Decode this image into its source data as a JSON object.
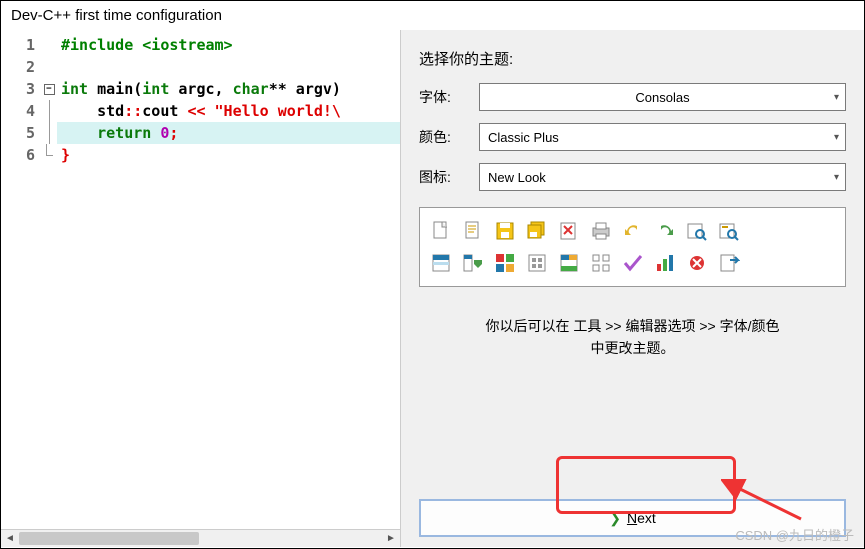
{
  "window": {
    "title": "Dev-C++ first time configuration"
  },
  "code": {
    "lines": [
      {
        "n": 1,
        "type": "pp",
        "text": "#include <iostream>"
      },
      {
        "n": 2,
        "type": "blank",
        "text": ""
      },
      {
        "n": 3,
        "type": "sig",
        "kw1": "int",
        "name": " main(",
        "kw2": "int",
        "mid": " argc, ",
        "kw3": "char",
        "rest": "** argv)"
      },
      {
        "n": 4,
        "type": "stmt",
        "pre": "    std",
        "op": "::",
        "mid": "cout ",
        "op2": "<<",
        "post": " ",
        "str": "\"Hello world!\\"
      },
      {
        "n": 5,
        "type": "ret",
        "pre": "    ",
        "kw": "return",
        "sp": " ",
        "num": "0",
        "semi": ";"
      },
      {
        "n": 6,
        "type": "close",
        "text": "}"
      }
    ]
  },
  "config": {
    "title": "选择你的主题:",
    "font_label": "字体:",
    "font_value": "Consolas",
    "color_label": "颜色:",
    "color_value": "Classic Plus",
    "icon_label": "图标:",
    "icon_value": "New Look",
    "hint_line1": "你以后可以在 工具 >> 编辑器选项 >> 字体/颜色",
    "hint_line2": "中更改主题。",
    "next_label": "Next"
  },
  "watermark": "CSDN @九日的橙子"
}
